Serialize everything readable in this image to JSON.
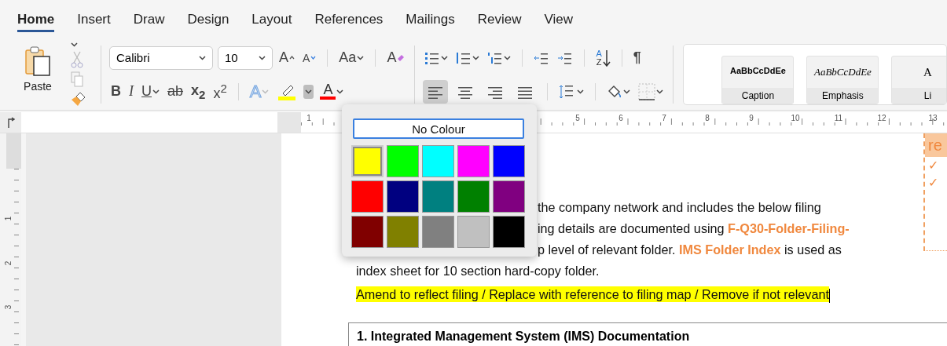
{
  "tabs": [
    {
      "label": "Home",
      "selected": true
    },
    {
      "label": "Insert",
      "selected": false
    },
    {
      "label": "Draw",
      "selected": false
    },
    {
      "label": "Design",
      "selected": false
    },
    {
      "label": "Layout",
      "selected": false
    },
    {
      "label": "References",
      "selected": false
    },
    {
      "label": "Mailings",
      "selected": false
    },
    {
      "label": "Review",
      "selected": false
    },
    {
      "label": "View",
      "selected": false
    }
  ],
  "clipboard": {
    "paste_label": "Paste"
  },
  "font": {
    "name": "Calibri",
    "size": "10",
    "grow_glyph": "A",
    "shrink_glyph": "A",
    "case_label": "Aa",
    "clear_glyph": "A"
  },
  "format_buttons": [
    {
      "kind": "bold",
      "label": "B"
    },
    {
      "kind": "italic",
      "label": "I"
    },
    {
      "kind": "underline",
      "label": "U"
    },
    {
      "kind": "strike",
      "label": "ab"
    },
    {
      "kind": "sub",
      "label": "x$_{2}$"
    },
    {
      "kind": "super",
      "label": "x$^{2}$"
    }
  ],
  "effects_button": {
    "label": "A"
  },
  "highlight_button": {
    "color": "#ffff00",
    "open": true
  },
  "font_color_button": {
    "label": "A",
    "color": "#ff0000"
  },
  "paragraph": {
    "sort_letters": [
      "A",
      "Z"
    ],
    "pilcrow": "¶"
  },
  "alignment": [
    {
      "kind": "left",
      "selected": true
    },
    {
      "kind": "center",
      "selected": false
    },
    {
      "kind": "right",
      "selected": false
    },
    {
      "kind": "justify",
      "selected": false
    }
  ],
  "styles": [
    {
      "kind": "bold",
      "sample": "AaBbCcDdEe",
      "name": "Caption"
    },
    {
      "kind": "italic",
      "sample": "AaBbCcDdEe",
      "name": "Emphasis"
    },
    {
      "kind": "serif",
      "sample": "A",
      "name": "Li"
    }
  ],
  "colour_menu": {
    "no_colour": "No Colour",
    "swatches": [
      {
        "color": "#ffff00",
        "selected": true
      },
      {
        "color": "#00ff00",
        "selected": false
      },
      {
        "color": "#00ffff",
        "selected": false
      },
      {
        "color": "#ff00ff",
        "selected": false
      },
      {
        "color": "#0000ff",
        "selected": false
      },
      {
        "color": "#ff0000",
        "selected": false
      },
      {
        "color": "#000080",
        "selected": false
      },
      {
        "color": "#008080",
        "selected": false
      },
      {
        "color": "#008000",
        "selected": false
      },
      {
        "color": "#800080",
        "selected": false
      },
      {
        "color": "#800000",
        "selected": false
      },
      {
        "color": "#808000",
        "selected": false
      },
      {
        "color": "#808080",
        "selected": false
      },
      {
        "color": "#c0c0c0",
        "selected": false
      },
      {
        "color": "#000000",
        "selected": false
      }
    ]
  },
  "ruler": {
    "marks": [
      "1",
      "5",
      "6",
      "7",
      "8",
      "9",
      "10",
      "11",
      "12",
      "13"
    ]
  },
  "vertical_ruler": {
    "marks": [
      "1",
      "2",
      "3"
    ]
  },
  "document": {
    "lines": [
      {
        "kind": "partial",
        "text": "the company network and includes the below filing"
      },
      {
        "kind": "partial",
        "text": "ing details are documented using **F-Q30-Folder-Filing-**"
      },
      {
        "kind": "partial",
        "text": "p level of relevant folder. **IMS Folder Index** is used as"
      },
      {
        "kind": "full",
        "text": "index sheet for 10 section hard-copy folder."
      },
      {
        "kind": "highlight",
        "text": "Amend to reflect filing / Replace with reference to filing map / Remove if not relevant"
      }
    ],
    "table_heading": "1. Integrated Management System (IMS) Documentation",
    "comment": {
      "title": "re",
      "items": [
        "✓",
        "✓"
      ]
    }
  }
}
